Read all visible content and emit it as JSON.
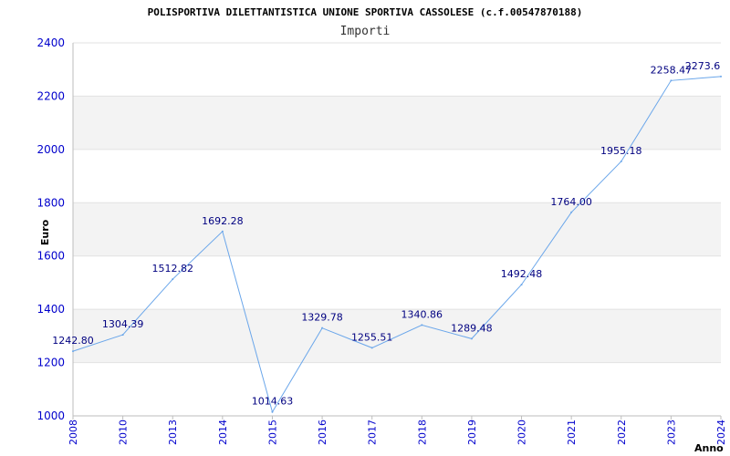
{
  "chart_data": {
    "type": "line",
    "title": "POLISPORTIVA DILETTANTISTICA UNIONE SPORTIVA CASSOLESE (c.f.00547870188)",
    "subtitle": "Importi",
    "xlabel": "Anno",
    "ylabel": "Euro",
    "categories": [
      "2008",
      "2010",
      "2013",
      "2014",
      "2015",
      "2016",
      "2017",
      "2018",
      "2019",
      "2020",
      "2021",
      "2022",
      "2023",
      "2024"
    ],
    "values": [
      1242.8,
      1304.39,
      1512.82,
      1692.28,
      1014.63,
      1329.78,
      1255.51,
      1340.86,
      1289.48,
      1492.48,
      1764.0,
      1955.18,
      2258.47,
      2273.6
    ],
    "value_labels": [
      "1242.80",
      "1304.39",
      "1512.82",
      "1692.28",
      "1014.63",
      "1329.78",
      "1255.51",
      "1340.86",
      "1289.48",
      "1492.48",
      "1764.00",
      "1955.18",
      "2258.47",
      "2273.6"
    ],
    "ylim": [
      1000,
      2400
    ],
    "yticks": [
      1000,
      1200,
      1400,
      1600,
      1800,
      2000,
      2200,
      2400
    ],
    "grid": "horizontal alternating bands",
    "colors": {
      "line": "#6aa6ea",
      "band": "#f3f3f3",
      "tick_text": "#0000cc",
      "data_label": "#000080"
    }
  }
}
